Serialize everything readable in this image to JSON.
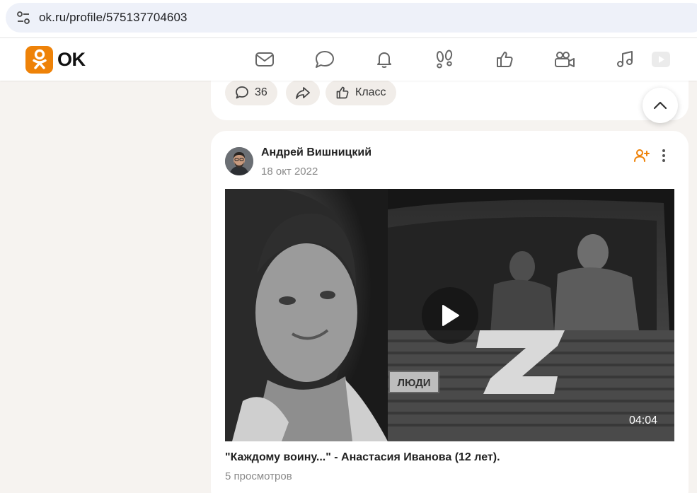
{
  "browser": {
    "url": "ok.ru/profile/575137704603",
    "settings_icon": "tune-icon"
  },
  "header": {
    "logo_text": "OK",
    "brand_color": "#ee8208",
    "nav_icons": [
      "mail-icon",
      "chat-icon",
      "bell-icon",
      "footprints-icon",
      "thumbs-up-icon",
      "video-camera-icon",
      "music-icon",
      "video-play-icon"
    ]
  },
  "prev_post": {
    "comments_count": "36",
    "like_label": "Класс"
  },
  "post": {
    "author": "Андрей Вишницкий",
    "date": "18 окт 2022",
    "video": {
      "duration": "04:04",
      "overlay_z": "Z",
      "overlay_sign": "ЛЮДИ",
      "title": "\"Каждому воину...\" - Анастасия Иванова (12 лет).",
      "views": "5 просмотров"
    }
  }
}
